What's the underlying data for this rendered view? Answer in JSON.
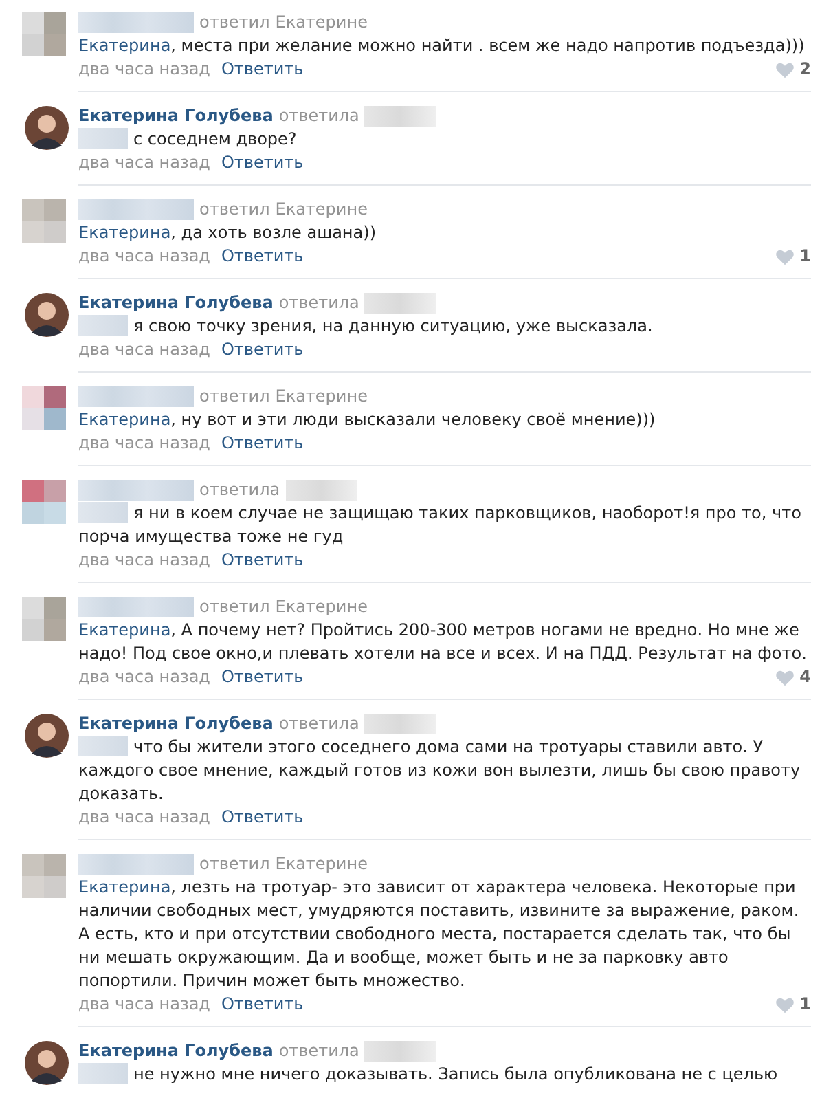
{
  "comments": [
    {
      "kind": "mosaic",
      "verb": "ответил",
      "reply_to": "Екатерине",
      "mention": "Екатерина",
      "text": ", места при желание можно найти . всем же надо напротив подъезда)))",
      "time": "два часа назад",
      "reply": "Ответить",
      "likes": "2"
    },
    {
      "kind": "photo",
      "author": "Екатерина Голубева",
      "verb": "ответила",
      "text": "с соседнем дворе?",
      "time": "два часа назад",
      "reply": "Ответить"
    },
    {
      "kind": "mosaic",
      "verb": "ответил",
      "reply_to": "Екатерине",
      "mention": "Екатерина",
      "text": ", да хоть возле ашана))",
      "time": "два часа назад",
      "reply": "Ответить",
      "likes": "1"
    },
    {
      "kind": "photo",
      "author": "Екатерина Голубева",
      "verb": "ответила",
      "text": "я свою точку зрения, на данную ситуацию, уже высказала.",
      "time": "два часа назад",
      "reply": "Ответить"
    },
    {
      "kind": "mosaic",
      "verb": "ответил",
      "reply_to": "Екатерине",
      "mention": "Екатерина",
      "text": ", ну вот и эти люди высказали человеку своё мнение)))",
      "time": "два часа назад",
      "reply": "Ответить"
    },
    {
      "kind": "mosaic",
      "verb": "ответила",
      "text": "я ни в коем случае не защищаю таких парковщиков, наоборот!я про то, что порча имущества тоже не гуд",
      "time": "два часа назад",
      "reply": "Ответить"
    },
    {
      "kind": "mosaic",
      "verb": "ответил",
      "reply_to": "Екатерине",
      "mention": "Екатерина",
      "text": ", А почему нет? Пройтись 200-300 метров ногами не вредно. Но мне же надо! Под свое окно,и плевать хотели на все и всех. И на ПДД. Результат на фото.",
      "time": "два часа назад",
      "reply": "Ответить",
      "likes": "4"
    },
    {
      "kind": "photo",
      "author": "Екатерина Голубева",
      "verb": "ответила",
      "text": "что бы жители этого соседнего дома сами на тротуары ставили авто. У каждого свое мнение, каждый готов из кожи вон вылезти, лишь бы свою правоту доказать.",
      "time": "два часа назад",
      "reply": "Ответить"
    },
    {
      "kind": "mosaic",
      "verb": "ответил",
      "reply_to": "Екатерине",
      "mention": "Екатерина",
      "text": ", лезть на тротуар- это зависит от характера человека. Некоторые при наличии свободных мест, умудряются поставить, извините за выражение, раком. А есть, кто и при отсутствии свободного места, постарается сделать так, что бы ни мешать окружающим. Да и вообще, может быть и не за парковку авто попортили. Причин может быть множество.",
      "time": "два часа назад",
      "reply": "Ответить",
      "likes": "1"
    },
    {
      "kind": "photo",
      "author": "Екатерина Голубева",
      "verb": "ответила",
      "text": "не нужно мне ничего доказывать. Запись была опубликована не с целью"
    }
  ]
}
